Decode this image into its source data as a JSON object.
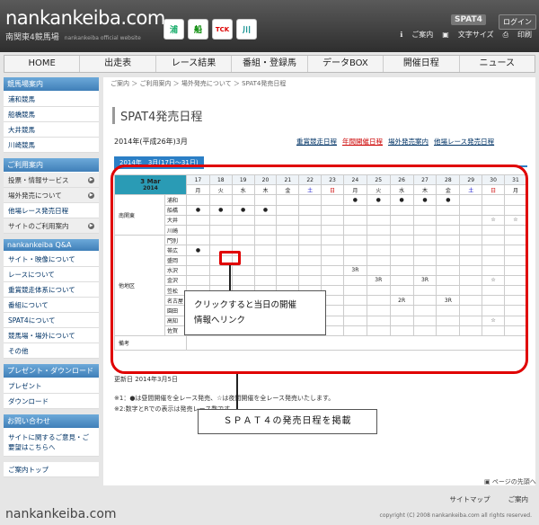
{
  "header": {
    "logo": "nankankeiba.com",
    "subtitle": "南関東4競馬場",
    "subtitle_small": "nankankeiba official website",
    "icon_labels": [
      "浦",
      "船",
      "TCK",
      "川"
    ],
    "spat_label": "SPAT4",
    "login_label": "ログイン",
    "links": [
      "ご案内",
      "文字サイズ",
      "印刷"
    ]
  },
  "nav": [
    "HOME",
    "出走表",
    "レース結果",
    "番組・登録馬",
    "データBOX",
    "開催日程",
    "ニュース"
  ],
  "sidebar": {
    "sec1_title": "競馬場案内",
    "sec1_items": [
      "浦和競馬",
      "船橋競馬",
      "大井競馬",
      "川崎競馬"
    ],
    "sec2_title": "ご利用案内",
    "sec2_items": [
      "投票・情報サービス",
      "場外発売について",
      "他場レース発売日程",
      "サイトのご利用案内"
    ],
    "sec3_title": "nankankeiba Q&A",
    "sec3_items": [
      "サイト・映像について",
      "レースについて",
      "重賞競走体系について",
      "番組について",
      "SPAT4について",
      "競馬場・場外について",
      "その他"
    ],
    "sec4_title": "プレゼント・ダウンロード",
    "sec4_items": [
      "プレゼント",
      "ダウンロード"
    ],
    "sec5_title": "お問い合わせ",
    "sec5_items": [
      "サイトに関するご意見・ご要望はこちらへ"
    ],
    "sec6_items": [
      "ご案内トップ"
    ]
  },
  "main": {
    "breadcrumb": "ご案内 ＞ ご利用案内 ＞ 場外発売について ＞ SPAT4発売日程",
    "title": "SPAT4発売日程",
    "period": "2014年(平成26年)3月",
    "links": [
      "重賞競走日程",
      "年間開催日程",
      "場外発売案内",
      "他場レース発売日程"
    ],
    "tab": "2014年　3月(17日～31日)",
    "updated": "更新日 2014年3月5日",
    "note1": "※1：●は昼間開催を全レース発売、☆は夜間開催を全レース発売いたします。",
    "note2": "※2:数字とRでの表示は発売レース数です。"
  },
  "schedule": {
    "month_label": "3 Mar",
    "year_label": "2014",
    "days": [
      "17",
      "18",
      "19",
      "20",
      "21",
      "22",
      "23",
      "24",
      "25",
      "26",
      "27",
      "28",
      "29",
      "30",
      "31"
    ],
    "weekdays": [
      "月",
      "火",
      "水",
      "木",
      "金",
      "土",
      "日",
      "月",
      "火",
      "水",
      "木",
      "金",
      "土",
      "日",
      "月"
    ],
    "groups": [
      {
        "name": "南関東",
        "rows": [
          {
            "venue": "浦和",
            "cells": [
              "",
              "",
              "",
              "",
              "",
              "",
              "",
              "●",
              "●",
              "●",
              "●",
              "●",
              "",
              "",
              ""
            ]
          },
          {
            "venue": "船橋",
            "cells": [
              "●",
              "●",
              "●",
              "●",
              "",
              "",
              "",
              "",
              "",
              "",
              "",
              "",
              "",
              "",
              ""
            ]
          },
          {
            "venue": "大井",
            "cells": [
              "",
              "",
              "",
              "",
              "",
              "",
              "",
              "",
              "",
              "",
              "",
              "",
              "",
              "☆",
              "☆"
            ]
          },
          {
            "venue": "川崎",
            "cells": [
              "",
              "",
              "",
              "",
              "",
              "",
              "",
              "",
              "",
              "",
              "",
              "",
              "",
              "",
              ""
            ]
          }
        ]
      },
      {
        "name": "他地区",
        "rows": [
          {
            "venue": "門別",
            "cells": [
              "",
              "",
              "",
              "",
              "",
              "",
              "",
              "",
              "",
              "",
              "",
              "",
              "",
              "",
              ""
            ]
          },
          {
            "venue": "帯広",
            "cells": [
              "●",
              "",
              "",
              "",
              "",
              "",
              "",
              "",
              "",
              "",
              "",
              "",
              "",
              "",
              ""
            ]
          },
          {
            "venue": "盛岡",
            "cells": [
              "",
              "",
              "",
              "",
              "",
              "",
              "",
              "",
              "",
              "",
              "",
              "",
              "",
              "",
              ""
            ]
          },
          {
            "venue": "水沢",
            "cells": [
              "",
              "",
              "",
              "",
              "",
              "",
              "",
              "3R",
              "",
              "",
              "",
              "",
              "",
              "",
              ""
            ]
          },
          {
            "venue": "金沢",
            "cells": [
              "",
              "",
              "",
              "",
              "",
              "",
              "",
              "",
              "3R",
              "",
              "3R",
              "",
              "",
              "☆",
              ""
            ]
          },
          {
            "venue": "笠松",
            "cells": [
              "",
              "",
              "",
              "",
              "",
              "",
              "",
              "",
              "",
              "",
              "",
              "",
              "",
              "",
              ""
            ]
          },
          {
            "venue": "名古屋",
            "cells": [
              "",
              "",
              "",
              "",
              "",
              "",
              "",
              "",
              "",
              "2R",
              "",
              "3R",
              "",
              "",
              ""
            ]
          },
          {
            "venue": "園田",
            "cells": [
              "",
              "",
              "",
              "",
              "",
              "",
              "",
              "",
              "",
              "",
              "",
              "",
              "",
              "",
              ""
            ]
          },
          {
            "venue": "高知",
            "cells": [
              "",
              "",
              "",
              "",
              "",
              "",
              "",
              "",
              "",
              "",
              "",
              "",
              "",
              "☆",
              ""
            ]
          },
          {
            "venue": "佐賀",
            "cells": [
              "3R",
              "",
              "",
              "",
              "",
              "",
              "",
              "",
              "",
              "",
              "",
              "",
              "",
              "",
              ""
            ]
          }
        ]
      }
    ],
    "remarks_label": "備考"
  },
  "annotations": {
    "callout1_line1": "クリックすると当日の開催",
    "callout1_line2": "情報へリンク",
    "callout2": "ＳＰＡＴ４の発売日程を掲載"
  },
  "footer": {
    "page_top": "ページの先頭へ",
    "links": [
      "サイトマップ",
      "ご案内"
    ],
    "logo": "nankankeiba.com",
    "copyright": "copyright (C) 2008 nankankeiba.com all rights reserved."
  },
  "colors": {
    "accent_blue": "#2b7fc6",
    "month_header": "#2a9bb5",
    "highlight_red": "#e00000",
    "saturday_blue": "#0000cc",
    "holiday_red": "#cc0000"
  }
}
